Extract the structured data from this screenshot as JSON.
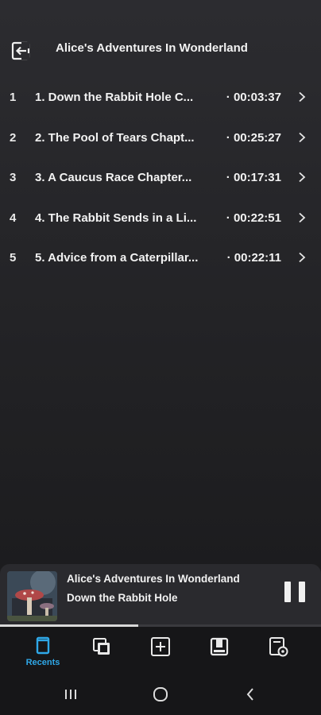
{
  "header": {
    "title": "Alice's Adventures In Wonderland",
    "back_icon": "exit-arrow-icon"
  },
  "chapters": [
    {
      "num": "1",
      "title": "1. Down the Rabbit Hole C...",
      "duration": "· 00:03:37"
    },
    {
      "num": "2",
      "title": "2. The Pool of Tears Chapt...",
      "duration": "· 00:25:27"
    },
    {
      "num": "3",
      "title": "3. A Caucus Race Chapter...",
      "duration": "· 00:17:31"
    },
    {
      "num": "4",
      "title": "4. The Rabbit Sends in a Li...",
      "duration": "· 00:22:51"
    },
    {
      "num": "5",
      "title": "5. Advice from a Caterpillar...",
      "duration": "· 00:22:11"
    }
  ],
  "player": {
    "title": "Alice's Adventures In Wonderland",
    "subtitle": "Down the Rabbit Hole",
    "progress": 0.43
  },
  "tabs": [
    {
      "label": "Recents",
      "icon": "book-icon",
      "active": true
    },
    {
      "label": "",
      "icon": "library-stack-icon"
    },
    {
      "label": "",
      "icon": "add-box-icon"
    },
    {
      "label": "",
      "icon": "bookmark-box-icon"
    },
    {
      "label": "",
      "icon": "settings-doc-icon"
    }
  ],
  "colors": {
    "accent": "#2fa8e8",
    "background": "#232326",
    "player_bg": "#2a2a2e"
  }
}
